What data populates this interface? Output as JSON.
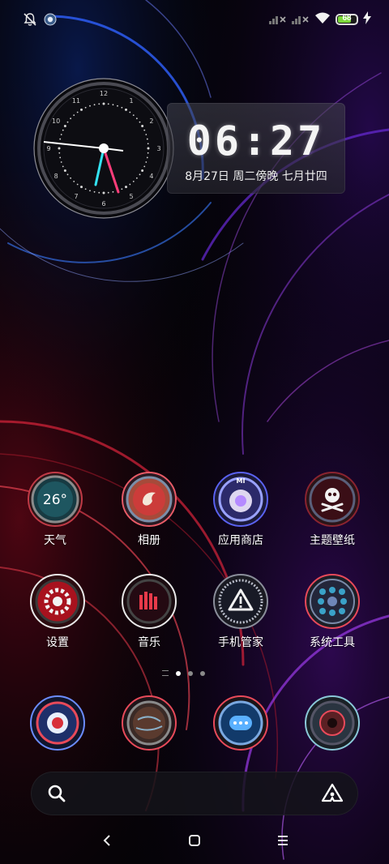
{
  "status_bar": {
    "left_icons": [
      "notifications-off-icon",
      "app-notification-icon"
    ],
    "right_icons": [
      "signal-no-service-icon",
      "signal-no-service-icon",
      "wifi-icon",
      "battery-icon",
      "charging-icon"
    ],
    "battery_level": "68"
  },
  "clock_widget": {
    "time": "06:27",
    "date": "8月27日 周二傍晚 七月廿四",
    "dial_numbers": [
      "12",
      "1",
      "2",
      "3",
      "4",
      "5",
      "6",
      "7",
      "8",
      "9",
      "10",
      "11"
    ]
  },
  "apps_row1": [
    {
      "label": "天气",
      "icon": "weather-icon",
      "badge_text": "26°"
    },
    {
      "label": "相册",
      "icon": "gallery-icon"
    },
    {
      "label": "应用商店",
      "icon": "app-store-icon",
      "badge_text": "MI"
    },
    {
      "label": "主题壁纸",
      "icon": "themes-icon"
    }
  ],
  "apps_row2": [
    {
      "label": "设置",
      "icon": "settings-icon"
    },
    {
      "label": "音乐",
      "icon": "music-icon"
    },
    {
      "label": "手机管家",
      "icon": "security-icon"
    },
    {
      "label": "系统工具",
      "icon": "tools-icon"
    }
  ],
  "page_indicator": {
    "pages": 3,
    "active": 0
  },
  "dock": [
    {
      "icon": "phone-icon"
    },
    {
      "icon": "browser-icon"
    },
    {
      "icon": "messages-icon"
    },
    {
      "icon": "camera-icon"
    }
  ],
  "search_bar": {
    "left_icon": "search-icon",
    "right_icon": "assistant-icon"
  },
  "nav_bar": {
    "icons": [
      "back-icon",
      "home-icon",
      "menu-icon"
    ]
  },
  "colors": {
    "accent_red": "#e83a4a",
    "accent_blue": "#3a7bff",
    "accent_purple": "#a23ad8",
    "battery_green": "#7bd83a"
  }
}
